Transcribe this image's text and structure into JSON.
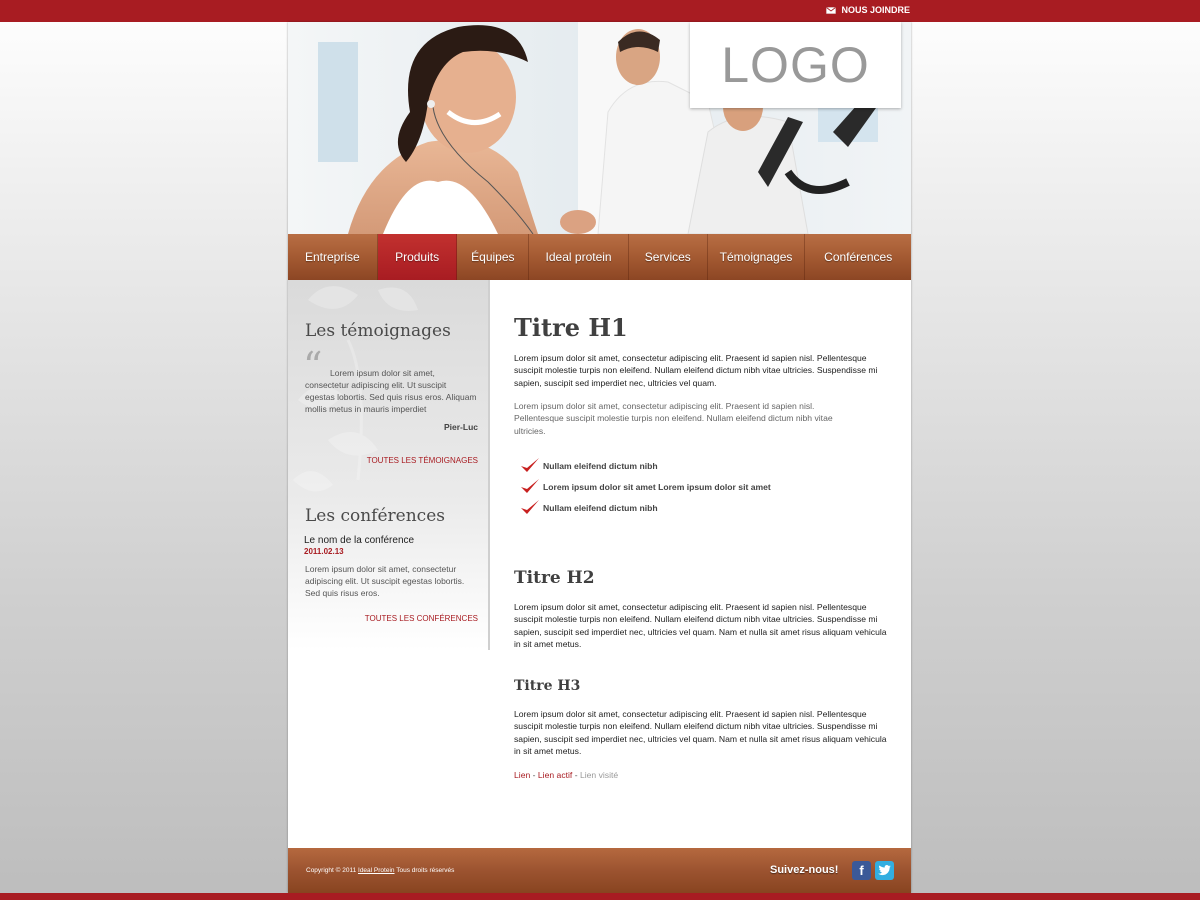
{
  "topbar": {
    "contact_label": "NOUS JOINDRE",
    "contact_icon": "mail-icon",
    "color": "#a81c22"
  },
  "header": {
    "logo_text": "LOGO",
    "hero_icon": "fitness-photo"
  },
  "nav": {
    "items": [
      {
        "label": "Entreprise",
        "active": false
      },
      {
        "label": "Produits",
        "active": true
      },
      {
        "label": "Équipes",
        "active": false
      },
      {
        "label": "Ideal protein",
        "active": false
      },
      {
        "label": "Services",
        "active": false
      },
      {
        "label": "Témoignages",
        "active": false
      },
      {
        "label": "Conférences",
        "active": false
      }
    ]
  },
  "sidebar": {
    "testimonials": {
      "heading": "Les témoignages",
      "quote": "Lorem ipsum dolor sit amet, consectetur adipiscing elit. Ut suscipit egestas lobortis. Sed quis risus eros. Aliquam mollis metus in mauris imperdiet",
      "author": "Pier-Luc",
      "all_link": "TOUTES LES TÉMOIGNAGES"
    },
    "conferences": {
      "heading": "Les conférences",
      "name": "Le nom de la conférence",
      "date": "2011.02.13",
      "text": "Lorem ipsum dolor sit amet, consectetur adipiscing elit. Ut suscipit egestas lobortis. Sed quis risus eros.",
      "all_link": "TOUTES LES CONFÉRENCES"
    }
  },
  "content": {
    "h1": "Titre H1",
    "p1": "Lorem ipsum dolor sit amet, consectetur adipiscing elit. Praesent id sapien nisl. Pellentesque suscipit molestie turpis non eleifend. Nullam eleifend dictum nibh vitae ultricies. Suspendisse mi sapien, suscipit sed imperdiet nec, ultricies vel quam.",
    "p2": "Lorem ipsum dolor sit amet, consectetur adipiscing elit. Praesent id sapien nisl. Pellentesque suscipit molestie turpis non eleifend. Nullam eleifend dictum nibh vitae ultricies.",
    "checklist": [
      "Nullam eleifend dictum nibh",
      "Lorem ipsum dolor sit amet Lorem ipsum dolor sit amet",
      "Nullam eleifend dictum nibh"
    ],
    "h2": "Titre H2",
    "p3": "Lorem ipsum dolor sit amet, consectetur adipiscing elit. Praesent id sapien nisl. Pellentesque suscipit molestie turpis non eleifend. Nullam eleifend dictum nibh vitae ultricies. Suspendisse mi sapien, suscipit sed imperdiet nec, ultricies vel quam. Nam et nulla sit amet risus aliquam vehicula in sit amet metus.",
    "h3": "Titre H3",
    "p4": "Lorem ipsum dolor sit amet, consectetur adipiscing elit. Praesent id sapien nisl. Pellentesque suscipit molestie turpis non eleifend. Nullam eleifend dictum nibh vitae ultricies. Suspendisse mi sapien, suscipit sed imperdiet nec, ultricies vel quam. Nam et nulla sit amet risus aliquam vehicula in sit amet metus.",
    "links": {
      "link": "Lien",
      "active": "Lien actif",
      "visited": "Lien visité",
      "separator": "-"
    }
  },
  "footer": {
    "copyright_prefix": "Copyright © 2011",
    "copyright_link": "Ideal Protein",
    "copyright_suffix": "Tous droits réservés",
    "follow": "Suivez-nous!",
    "facebook_icon": "facebook-icon",
    "twitter_icon": "twitter-icon"
  },
  "colors": {
    "accent": "#a81c22",
    "wood": "#a45a32",
    "link_visited": "#999999"
  }
}
